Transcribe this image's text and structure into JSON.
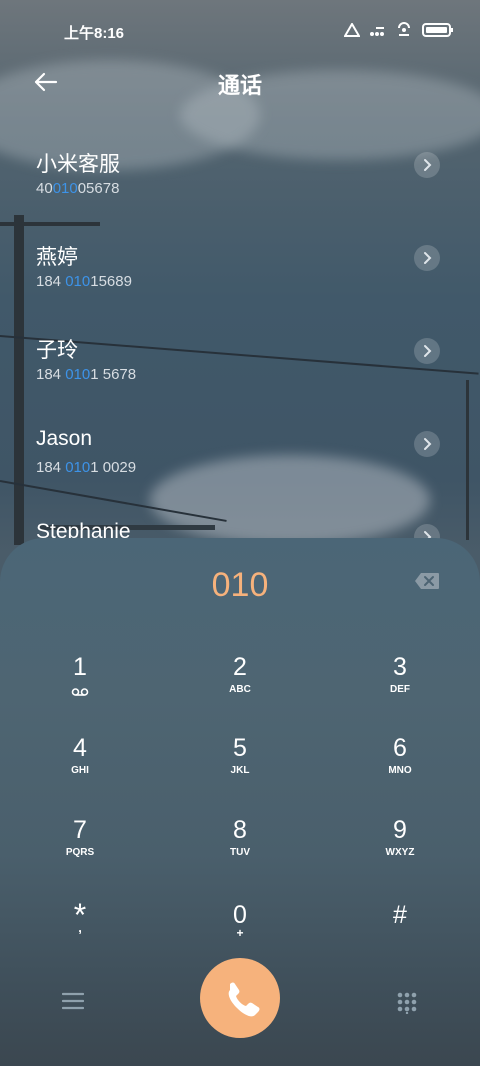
{
  "status_bar": {
    "time": "上午8:16"
  },
  "header": {
    "title": "通话"
  },
  "contacts": [
    {
      "name": "小米客服",
      "number_pre": "40",
      "number_match": "010",
      "number_post": "05678"
    },
    {
      "name": "燕婷",
      "number_pre": "184 ",
      "number_match": "010",
      "number_post": "15689"
    },
    {
      "name": "子玲",
      "number_pre": "184 ",
      "number_match": "010",
      "number_post": "1 5678"
    },
    {
      "name": "Jason",
      "number_pre": "184 ",
      "number_match": "010",
      "number_post": "1 0029"
    },
    {
      "name": "Stephanie",
      "number_pre": "",
      "number_match": "",
      "number_post": ""
    }
  ],
  "dialer": {
    "entry": "010",
    "keys": [
      {
        "digit": "1",
        "letters": ""
      },
      {
        "digit": "2",
        "letters": "ABC"
      },
      {
        "digit": "3",
        "letters": "DEF"
      },
      {
        "digit": "4",
        "letters": "GHI"
      },
      {
        "digit": "5",
        "letters": "JKL"
      },
      {
        "digit": "6",
        "letters": "MNO"
      },
      {
        "digit": "7",
        "letters": "PQRS"
      },
      {
        "digit": "8",
        "letters": "TUV"
      },
      {
        "digit": "9",
        "letters": "WXYZ"
      },
      {
        "digit": "*",
        "letters": ","
      },
      {
        "digit": "0",
        "letters": "+"
      },
      {
        "digit": "#",
        "letters": ""
      }
    ]
  },
  "colors": {
    "accent": "#f6b27c",
    "match_highlight": "#3d93e8"
  }
}
